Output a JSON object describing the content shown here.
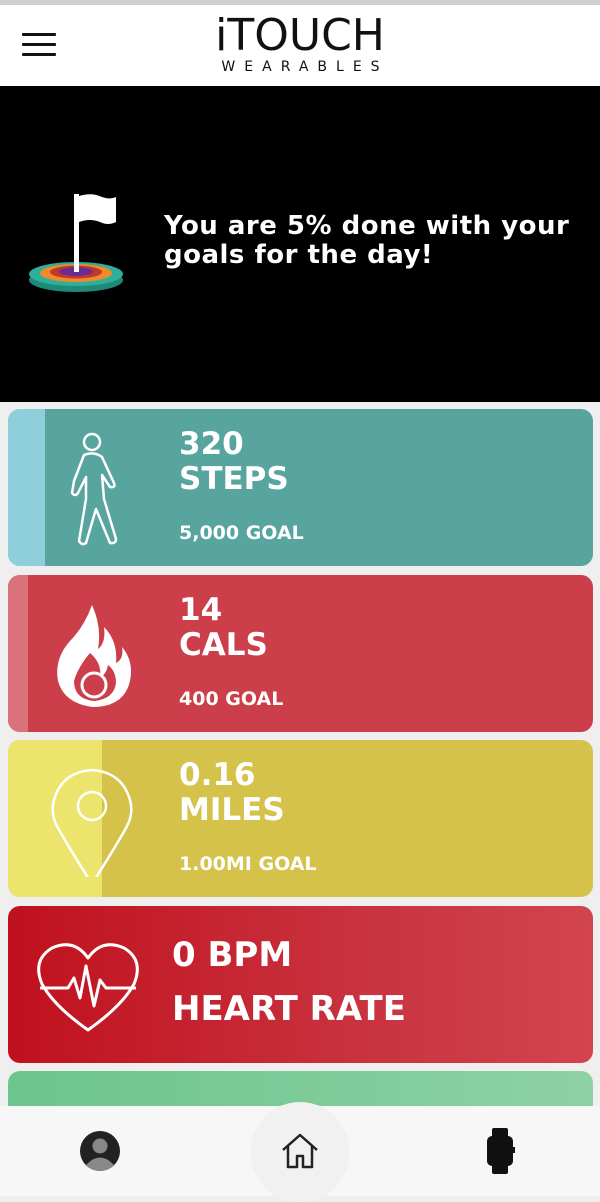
{
  "header": {
    "logo_main": "iTOUCH",
    "logo_sub": "WEARABLES"
  },
  "banner": {
    "message": "You are 5% done with your goals for the day!",
    "progress_percent": 5
  },
  "cards": {
    "steps": {
      "value": "320",
      "unit": "STEPS",
      "goal": "5,000 GOAL",
      "progress_fraction": 0.064
    },
    "calories": {
      "value": "14",
      "unit": "CALS",
      "goal": "400 GOAL",
      "progress_fraction": 0.035
    },
    "miles": {
      "value": "0.16",
      "unit": "MILES",
      "goal": "1.00MI GOAL",
      "progress_fraction": 0.16
    },
    "heart_rate": {
      "value": "0 BPM",
      "label": "HEART RATE"
    }
  },
  "colors": {
    "steps": "#57a59e",
    "calories": "#cc3f4a",
    "miles": "#d4c24b",
    "heart_rate": "#c0111d"
  },
  "nav": {
    "icons": [
      "profile-icon",
      "home-icon",
      "watch-icon"
    ]
  }
}
